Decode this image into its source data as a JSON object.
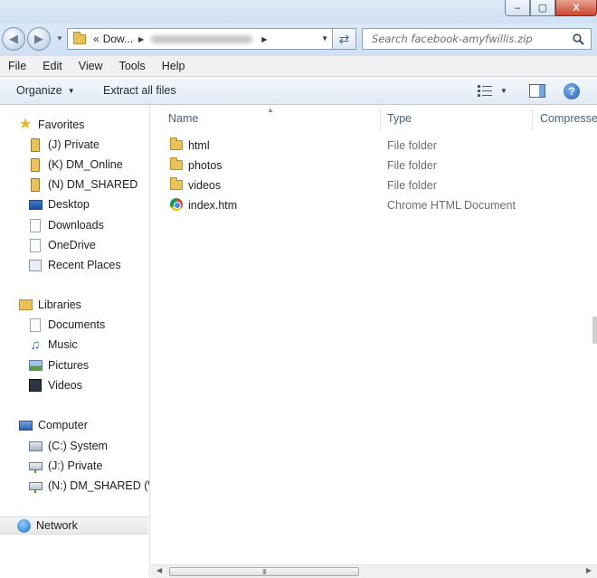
{
  "window": {
    "caption_buttons": {
      "minimize": "–",
      "maximize": "▢",
      "close": "X"
    }
  },
  "navbar": {
    "back_icon": "back-arrow-icon",
    "forward_icon": "forward-arrow-icon",
    "address": {
      "overflow_chevron": "«",
      "crumb": "Dow...",
      "blurred": "facebook-amyfwillis"
    },
    "search": {
      "placeholder": "Search facebook-amyfwillis.zip"
    }
  },
  "menubar": {
    "items": [
      "File",
      "Edit",
      "View",
      "Tools",
      "Help"
    ]
  },
  "toolbar": {
    "organize_label": "Organize",
    "extract_label": "Extract all files"
  },
  "navpane": {
    "favorites_header": "Favorites",
    "favorites": [
      "(J) Private",
      "(K) DM_Online",
      "(N) DM_SHARED",
      "Desktop",
      "Downloads",
      "OneDrive",
      "Recent Places"
    ],
    "libraries_header": "Libraries",
    "libraries": [
      "Documents",
      "Music",
      "Pictures",
      "Videos"
    ],
    "computer_header": "Computer",
    "computer": [
      "(C:) System",
      "(J:) Private",
      "(N:) DM_SHARED (\\\\"
    ],
    "network_label": "Network"
  },
  "content": {
    "columns": [
      "Name",
      "Type",
      "Compresse"
    ],
    "files": [
      {
        "name": "html",
        "type": "File folder",
        "icon": "folder-icon"
      },
      {
        "name": "photos",
        "type": "File folder",
        "icon": "folder-icon"
      },
      {
        "name": "videos",
        "type": "File folder",
        "icon": "folder-icon"
      },
      {
        "name": "index.htm",
        "type": "Chrome HTML Document",
        "icon": "chrome-icon"
      }
    ]
  },
  "scrollbar": {
    "grip": "III"
  },
  "colors": {
    "chrome_bg": "#cfe1f3",
    "accent_blue": "#1d5bb8",
    "folder_yellow": "#e9c25a",
    "close_red": "#c9462c"
  }
}
